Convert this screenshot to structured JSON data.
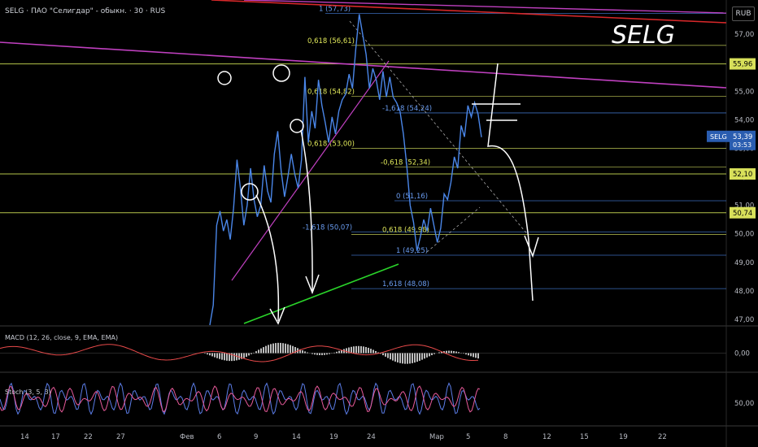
{
  "header": {
    "symbol_line": "SELG · ПАО \"Селигдар\" - обыкн. · 30 · RUS",
    "currency": "RUB",
    "brand": "SELG"
  },
  "colors": {
    "price_line": "#4a86e8",
    "fib_line": "#c8d45a",
    "level_line": "#b5c44a",
    "trend_magenta": "#c040c0",
    "trend_red": "#d8282a",
    "trend_green": "#2ad42a",
    "macd_hist": "#bdbdbd",
    "macd_signal": "#e84a4a",
    "stoch_k": "#5b7de8",
    "stoch_d": "#e85a9a"
  },
  "price_axis": {
    "ticks": [
      "57,00",
      "56,00",
      "55,00",
      "54,00",
      "53,00",
      "52,00",
      "51,00",
      "50,00",
      "49,00",
      "48,00",
      "47,00"
    ],
    "labels": [
      {
        "text": "55,96",
        "kind": "level"
      },
      {
        "text": "52,10",
        "kind": "level"
      },
      {
        "text": "50,74",
        "kind": "level"
      },
      {
        "text": "SELG",
        "kind": "price"
      },
      {
        "text": "53,39",
        "kind": "price"
      },
      {
        "text": "03:53",
        "kind": "price"
      }
    ]
  },
  "macd": {
    "label": "MACD (12, 26, close, 9, EMA, EMA)",
    "tick": "0,00"
  },
  "stoch": {
    "label": "Stoch (3, 5, 3)",
    "tick": "50,00"
  },
  "time_axis": [
    "14",
    "17",
    "22",
    "27",
    "Фев",
    "6",
    "9",
    "14",
    "19",
    "24",
    "Мар",
    "5",
    "8",
    "12",
    "15",
    "19",
    "22"
  ],
  "chart_data": {
    "type": "line",
    "title": "SELG · ПАО \"Селигдар\" - обыкн. · 30 · RUS",
    "ylim": [
      46.8,
      58.2
    ],
    "fib_labels": [
      {
        "text": "1 (57,73)",
        "value": 57.73,
        "color": "blue"
      },
      {
        "text": "0,618 (56,61)",
        "value": 56.61,
        "color": "yellow"
      },
      {
        "text": "0,618 (54,82)",
        "value": 54.82,
        "color": "yellow"
      },
      {
        "text": "-1,618 (54,24)",
        "value": 54.24,
        "color": "blue"
      },
      {
        "text": "0,618 (53,00)",
        "value": 53.0,
        "color": "yellow"
      },
      {
        "text": "-0,618 (52,34)",
        "value": 52.34,
        "color": "yellow"
      },
      {
        "text": "0 (51,16)",
        "value": 51.16,
        "color": "blue"
      },
      {
        "text": "-1,618 (50,07)",
        "value": 50.07,
        "color": "blue"
      },
      {
        "text": "0,618 (49,98)",
        "value": 49.98,
        "color": "yellow"
      },
      {
        "text": "1 (49,25)",
        "value": 49.25,
        "color": "blue"
      },
      {
        "text": "1,618 (48,08)",
        "value": 48.08,
        "color": "blue"
      }
    ],
    "levels": [
      55.96,
      52.1,
      50.74
    ],
    "series": [
      {
        "values": [
          46.8,
          47.5,
          50.3,
          50.8,
          50.1,
          50.5,
          49.8,
          50.9,
          52.6,
          51.6,
          50.3,
          51.0,
          52.3,
          51.2,
          50.6,
          51.0,
          52.4,
          51.5,
          51.1,
          52.8,
          53.6,
          52.2,
          51.3,
          52.0,
          52.8,
          52.1,
          51.6,
          52.6,
          55.5,
          53.2,
          54.3,
          53.7,
          55.4,
          54.5,
          53.9,
          53.2,
          54.1,
          53.5,
          54.3,
          54.7,
          54.9,
          55.6,
          55.1,
          56.5,
          57.7,
          57.0,
          56.3,
          55.1,
          55.8,
          55.4,
          54.7,
          55.7,
          54.8,
          55.5,
          54.8,
          54.6,
          54.3,
          53.5,
          52.4,
          51.0,
          50.4,
          49.4,
          49.9,
          50.5,
          50.1,
          50.9,
          50.3,
          49.7,
          50.2,
          51.4,
          51.2,
          51.8,
          52.7,
          52.3,
          53.8,
          53.4,
          54.5,
          54.1,
          54.6,
          54.2,
          53.39
        ]
      }
    ]
  }
}
